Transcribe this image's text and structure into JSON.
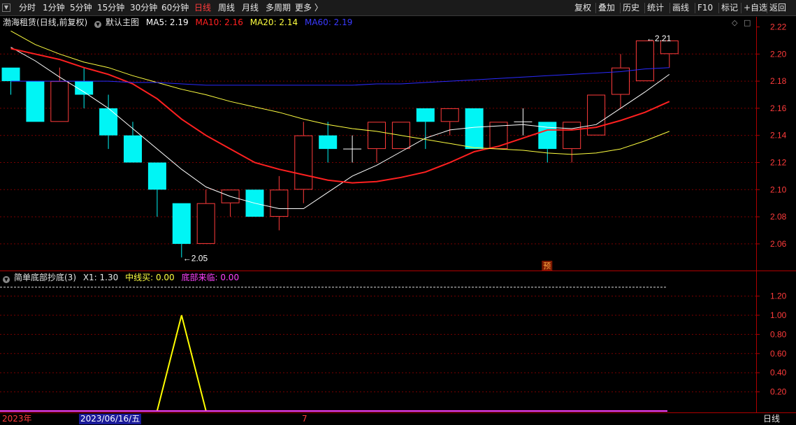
{
  "toolbar": {
    "periods": [
      "分时",
      "1分钟",
      "5分钟",
      "15分钟",
      "30分钟",
      "60分钟",
      "日线",
      "周线",
      "月线",
      "多周期",
      "更多 〉"
    ],
    "active_period": "日线",
    "right_buttons": [
      "复权",
      "叠加",
      "历史",
      "统计",
      "画线",
      "F10",
      "标记",
      "+自选",
      "返回"
    ]
  },
  "main_legend": {
    "stock_title": "渤海租赁",
    "mode": "(日线,前复权)",
    "chart_name": "默认主图",
    "ma5": "MA5: 2.19",
    "ma10": "MA10: 2.16",
    "ma20": "MA20: 2.14",
    "ma60": "MA60: 2.19"
  },
  "sub_legend": {
    "indicator": "简单底部抄底(3)",
    "x1": "X1: 1.30",
    "mid_buy": "中线买: 0.00",
    "bottom_come": "底部来临: 0.00"
  },
  "colors": {
    "up": "#ff3b3b",
    "down": "#00f5f5",
    "ma5": "#ffffff",
    "ma10": "#ff2020",
    "ma20": "#ffff40",
    "ma60": "#2a2aff",
    "grid": "#7a0000",
    "sub_yellow": "#ffff00",
    "sub_magenta": "#ff40ff"
  },
  "chart_data": [
    {
      "type": "candlestick",
      "ylim": [
        2.045,
        2.225
      ],
      "y_ticks": [
        "2.22",
        "2.20",
        "2.18",
        "2.16",
        "2.14",
        "2.12",
        "2.10",
        "2.08",
        "2.06"
      ],
      "candles": [
        {
          "o": 2.19,
          "h": 2.19,
          "l": 2.17,
          "c": 2.18
        },
        {
          "o": 2.18,
          "h": 2.18,
          "l": 2.15,
          "c": 2.15
        },
        {
          "o": 2.15,
          "h": 2.19,
          "l": 2.15,
          "c": 2.18
        },
        {
          "o": 2.18,
          "h": 2.19,
          "l": 2.16,
          "c": 2.17
        },
        {
          "o": 2.16,
          "h": 2.17,
          "l": 2.13,
          "c": 2.14
        },
        {
          "o": 2.14,
          "h": 2.15,
          "l": 2.12,
          "c": 2.12
        },
        {
          "o": 2.12,
          "h": 2.12,
          "l": 2.08,
          "c": 2.1
        },
        {
          "o": 2.09,
          "h": 2.09,
          "l": 2.05,
          "c": 2.06
        },
        {
          "o": 2.06,
          "h": 2.1,
          "l": 2.06,
          "c": 2.09
        },
        {
          "o": 2.09,
          "h": 2.1,
          "l": 2.08,
          "c": 2.1
        },
        {
          "o": 2.1,
          "h": 2.1,
          "l": 2.08,
          "c": 2.08
        },
        {
          "o": 2.08,
          "h": 2.11,
          "l": 2.07,
          "c": 2.1
        },
        {
          "o": 2.1,
          "h": 2.15,
          "l": 2.09,
          "c": 2.14
        },
        {
          "o": 2.14,
          "h": 2.15,
          "l": 2.12,
          "c": 2.13
        },
        {
          "o": 2.13,
          "h": 2.14,
          "l": 2.12,
          "c": 2.13
        },
        {
          "o": 2.13,
          "h": 2.15,
          "l": 2.12,
          "c": 2.15
        },
        {
          "o": 2.13,
          "h": 2.15,
          "l": 2.13,
          "c": 2.15
        },
        {
          "o": 2.16,
          "h": 2.16,
          "l": 2.13,
          "c": 2.15
        },
        {
          "o": 2.15,
          "h": 2.16,
          "l": 2.14,
          "c": 2.16
        },
        {
          "o": 2.16,
          "h": 2.16,
          "l": 2.13,
          "c": 2.13
        },
        {
          "o": 2.13,
          "h": 2.15,
          "l": 2.13,
          "c": 2.15
        },
        {
          "o": 2.15,
          "h": 2.16,
          "l": 2.14,
          "c": 2.15
        },
        {
          "o": 2.15,
          "h": 2.15,
          "l": 2.12,
          "c": 2.13
        },
        {
          "o": 2.13,
          "h": 2.15,
          "l": 2.12,
          "c": 2.15
        },
        {
          "o": 2.14,
          "h": 2.17,
          "l": 2.14,
          "c": 2.17
        },
        {
          "o": 2.17,
          "h": 2.2,
          "l": 2.16,
          "c": 2.19
        },
        {
          "o": 2.18,
          "h": 2.21,
          "l": 2.18,
          "c": 2.21
        },
        {
          "o": 2.2,
          "h": 2.21,
          "l": 2.19,
          "c": 2.21
        }
      ],
      "series": [
        {
          "name": "MA5",
          "values": [
            2.205,
            2.195,
            2.183,
            2.172,
            2.16,
            2.145,
            2.13,
            2.115,
            2.102,
            2.095,
            2.09,
            2.086,
            2.086,
            2.098,
            2.11,
            2.118,
            2.128,
            2.138,
            2.144,
            2.146,
            2.147,
            2.148,
            2.146,
            2.145,
            2.148,
            2.16,
            2.172,
            2.185
          ]
        },
        {
          "name": "MA10",
          "values": [
            2.204,
            2.2,
            2.196,
            2.19,
            2.185,
            2.178,
            2.167,
            2.152,
            2.14,
            2.13,
            2.12,
            2.115,
            2.111,
            2.107,
            2.105,
            2.106,
            2.109,
            2.113,
            2.12,
            2.128,
            2.132,
            2.138,
            2.144,
            2.144,
            2.146,
            2.151,
            2.157,
            2.165
          ]
        },
        {
          "name": "MA20",
          "values": [
            2.217,
            2.207,
            2.2,
            2.194,
            2.19,
            2.184,
            2.179,
            2.174,
            2.17,
            2.165,
            2.161,
            2.157,
            2.152,
            2.148,
            2.145,
            2.143,
            2.14,
            2.137,
            2.134,
            2.131,
            2.13,
            2.129,
            2.127,
            2.126,
            2.127,
            2.13,
            2.136,
            2.143
          ]
        },
        {
          "name": "MA60",
          "values": [
            2.18,
            2.18,
            2.18,
            2.18,
            2.18,
            2.179,
            2.179,
            2.178,
            2.177,
            2.177,
            2.177,
            2.177,
            2.177,
            2.177,
            2.177,
            2.178,
            2.178,
            2.179,
            2.18,
            2.181,
            2.182,
            2.183,
            2.184,
            2.185,
            2.186,
            2.187,
            2.189,
            2.19
          ]
        }
      ],
      "annotations": [
        {
          "label": "←2.05",
          "index": 7,
          "price": 2.05
        },
        {
          "label": "←2.21",
          "index": 26,
          "price": 2.21
        },
        {
          "label": "预",
          "index": 22
        }
      ]
    },
    {
      "type": "line",
      "ylim": [
        0,
        1.4
      ],
      "y_ticks": [
        "1.20",
        "1.00",
        "0.80",
        "0.60",
        "0.40",
        "0.20"
      ],
      "series": [
        {
          "name": "X1",
          "values": [
            0,
            0,
            0,
            0,
            0,
            0,
            0,
            1.0,
            0,
            0,
            0,
            0,
            0,
            0,
            0,
            0,
            0,
            0,
            0,
            0,
            0,
            0,
            0,
            0,
            0,
            0,
            0,
            0
          ]
        },
        {
          "name": "底部来临",
          "values": [
            0,
            0,
            0,
            0,
            0,
            0,
            0,
            0,
            0,
            0,
            0,
            0,
            0,
            0,
            0,
            0,
            0,
            0,
            0,
            0,
            0,
            0,
            0,
            0,
            0,
            0,
            0,
            0
          ]
        }
      ],
      "ref_line": 1.3
    }
  ],
  "bottom_bar": {
    "year_label": "2023年",
    "cursor_date": "2023/06/16/五",
    "month_label": "7",
    "period_label": "日线"
  }
}
